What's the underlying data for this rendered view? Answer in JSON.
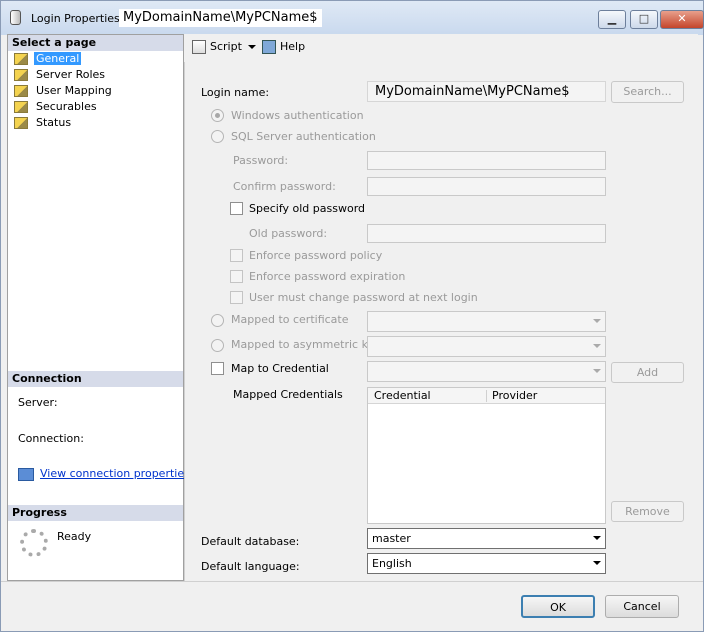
{
  "window": {
    "title": "Login Properties",
    "title_name": "MyDomainName\\MyPCName$",
    "minimize": "▁",
    "maximize": "□",
    "close": "✕"
  },
  "sidebar": {
    "select_header": "Select a page",
    "pages": [
      {
        "label": "General",
        "selected": true
      },
      {
        "label": "Server Roles",
        "selected": false
      },
      {
        "label": "User Mapping",
        "selected": false
      },
      {
        "label": "Securables",
        "selected": false
      },
      {
        "label": "Status",
        "selected": false
      }
    ],
    "connection_header": "Connection",
    "server_label": "Server:",
    "connection_label": "Connection:",
    "view_link": "View connection properties",
    "progress_header": "Progress",
    "progress_status": "Ready"
  },
  "toolbar": {
    "script": "Script",
    "help": "Help"
  },
  "form": {
    "login_name_label": "Login name:",
    "login_name_value": "MyDomainName\\MyPCName$",
    "search_button": "Search...",
    "windows_auth": "Windows authentication",
    "sql_auth": "SQL Server authentication",
    "password_label": "Password:",
    "confirm_password_label": "Confirm password:",
    "specify_old_password": "Specify old password",
    "old_password_label": "Old password:",
    "enforce_policy": "Enforce password policy",
    "enforce_expiration": "Enforce password expiration",
    "must_change": "User must change password at next login",
    "mapped_certificate": "Mapped to certificate",
    "mapped_asymmetric": "Mapped to asymmetric key",
    "map_credential": "Map to Credential",
    "add_button": "Add",
    "mapped_credentials_label": "Mapped Credentials",
    "credentials_columns": [
      "Credential",
      "Provider"
    ],
    "remove_button": "Remove",
    "default_database_label": "Default database:",
    "default_database_value": "master",
    "default_language_label": "Default language:",
    "default_language_value": "English"
  },
  "footer": {
    "ok": "OK",
    "cancel": "Cancel"
  }
}
